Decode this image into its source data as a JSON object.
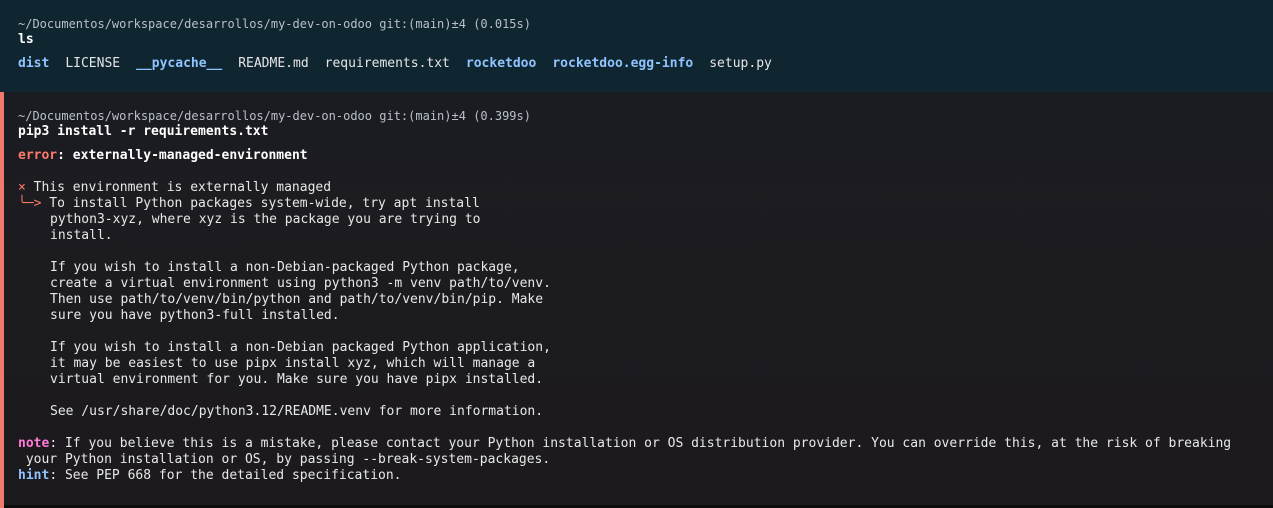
{
  "block1": {
    "path": "~/Documentos/workspace/desarrollos/my-dev-on-odoo",
    "git": "git:(main)±4",
    "time": "(0.015s)",
    "command": "ls",
    "files": [
      {
        "name": "dist",
        "dir": true
      },
      {
        "name": "LICENSE",
        "dir": false
      },
      {
        "name": "__pycache__",
        "dir": true
      },
      {
        "name": "README.md",
        "dir": false
      },
      {
        "name": "requirements.txt",
        "dir": false
      },
      {
        "name": "rocketdoo",
        "dir": true
      },
      {
        "name": "rocketdoo.egg-info",
        "dir": true
      },
      {
        "name": "setup.py",
        "dir": false
      }
    ]
  },
  "block2": {
    "path": "~/Documentos/workspace/desarrollos/my-dev-on-odoo",
    "git": "git:(main)±4",
    "time": "(0.399s)",
    "command": "pip3 install -r requirements.txt",
    "error_label": "error",
    "error_text": "externally-managed-environment",
    "x_mark": "×",
    "x_text": "This environment is externally managed",
    "arrow": "╰─>",
    "body": [
      "To install Python packages system-wide, try apt install",
      "python3-xyz, where xyz is the package you are trying to",
      "install.",
      "",
      "If you wish to install a non-Debian-packaged Python package,",
      "create a virtual environment using python3 -m venv path/to/venv.",
      "Then use path/to/venv/bin/python and path/to/venv/bin/pip. Make",
      "sure you have python3-full installed.",
      "",
      "If you wish to install a non-Debian packaged Python application,",
      "it may be easiest to use pipx install xyz, which will manage a",
      "virtual environment for you. Make sure you have pipx installed.",
      "",
      "See /usr/share/doc/python3.12/README.venv for more information."
    ],
    "note_label": "note",
    "note_text_1": ": If you believe this is a mistake, please contact your Python installation or OS distribution provider. You can override this, at the risk of breaking",
    "note_text_2": " your Python installation or OS, by passing --break-system-packages.",
    "hint_label": "hint",
    "hint_text": ": See PEP 668 for the detailed specification."
  }
}
